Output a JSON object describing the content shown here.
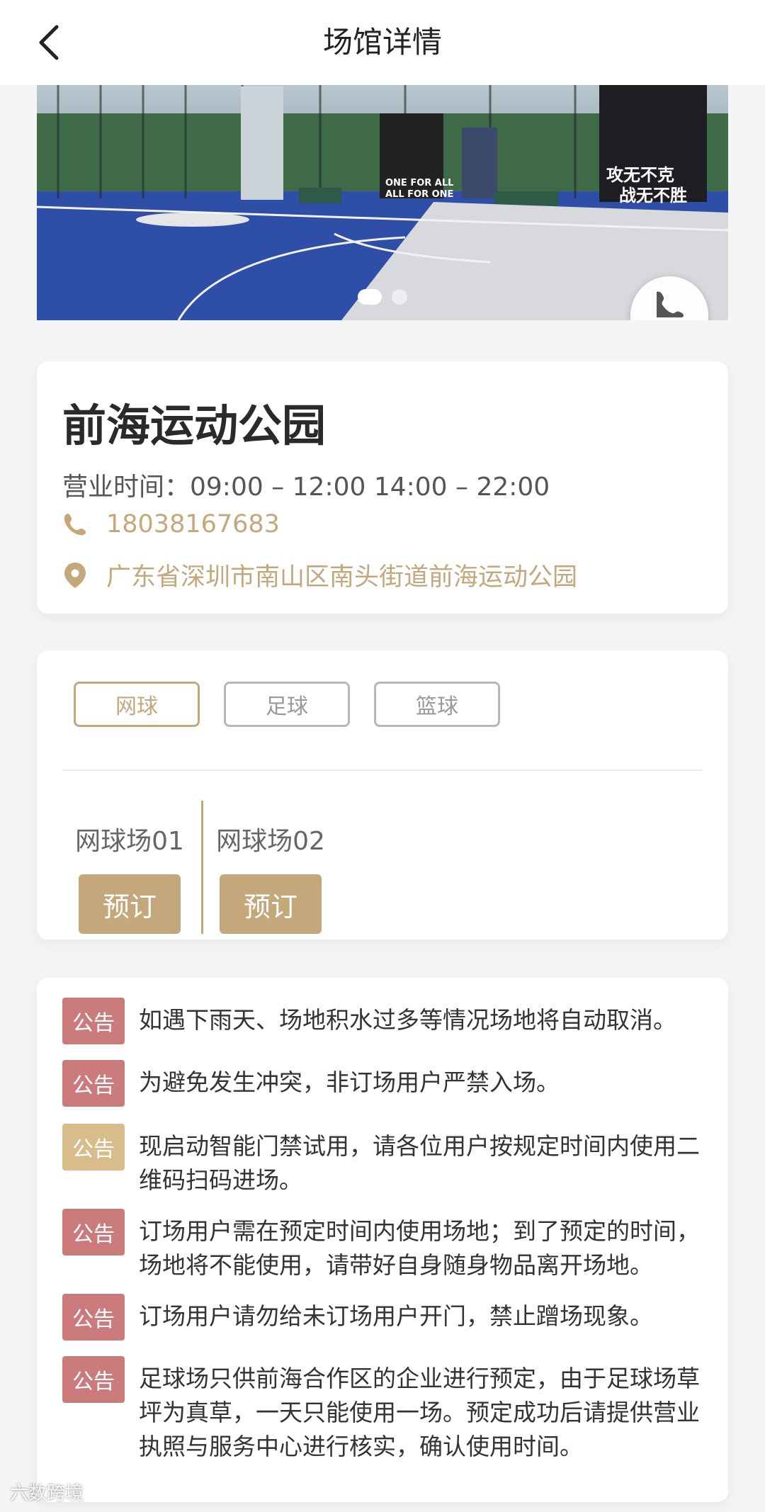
{
  "nav": {
    "title": "场馆详情",
    "back_icon": "chevron-left-icon"
  },
  "banner": {
    "slogans": [
      "ONE FOR ALL",
      "ALL FOR ONE",
      "攻无不克",
      "战无不胜"
    ],
    "page_count": 2,
    "active_page": 1,
    "call_icon": "phone-icon"
  },
  "venue": {
    "name": "前海运动公园",
    "hours": "营业时间：09:00 – 12:00 14:00 – 22:00",
    "phone": "18038167683",
    "address": "广东省深圳市南山区南头街道前海运动公园",
    "phone_icon": "phone-icon",
    "location_icon": "location-pin-icon"
  },
  "sports": {
    "tabs": [
      "网球",
      "足球",
      "篮球"
    ],
    "selected": "网球"
  },
  "courts": [
    {
      "name": "网球场01",
      "button": "预订"
    },
    {
      "name": "网球场02",
      "button": "预订"
    }
  ],
  "notices": [
    {
      "tag": "公告",
      "tag_color": "#cc7b7d",
      "text": "如遇下雨天、场地积水过多等情况场地将自动取消。"
    },
    {
      "tag": "公告",
      "tag_color": "#cc7b7d",
      "text": "为避免发生冲突，非订场用户严禁入场。"
    },
    {
      "tag": "公告",
      "tag_color": "#d9bc8c",
      "text": "现启动智能门禁试用，请各位用户按规定时间内使用二维码扫码进场。"
    },
    {
      "tag": "公告",
      "tag_color": "#cc7b7d",
      "text": "订场用户需在预定时间内使用场地；到了预定的时间，场地将不能使用，请带好自身随身物品离开场地。"
    },
    {
      "tag": "公告",
      "tag_color": "#cc7b7d",
      "text": "订场用户请勿给未订场用户开门，禁止蹭场现象。"
    },
    {
      "tag": "公告",
      "tag_color": "#cc7b7d",
      "text": "足球场只供前海合作区的企业进行预定，由于足球场草坪为真草，一天只能使用一场。预定成功后请提供营业执照与服务中心进行核实，确认使用时间。"
    }
  ],
  "watermark": "六数跨境",
  "colors": {
    "accent": "#c5a77c",
    "notice_red": "#cc7b7d",
    "notice_gold": "#d9bc8c"
  }
}
